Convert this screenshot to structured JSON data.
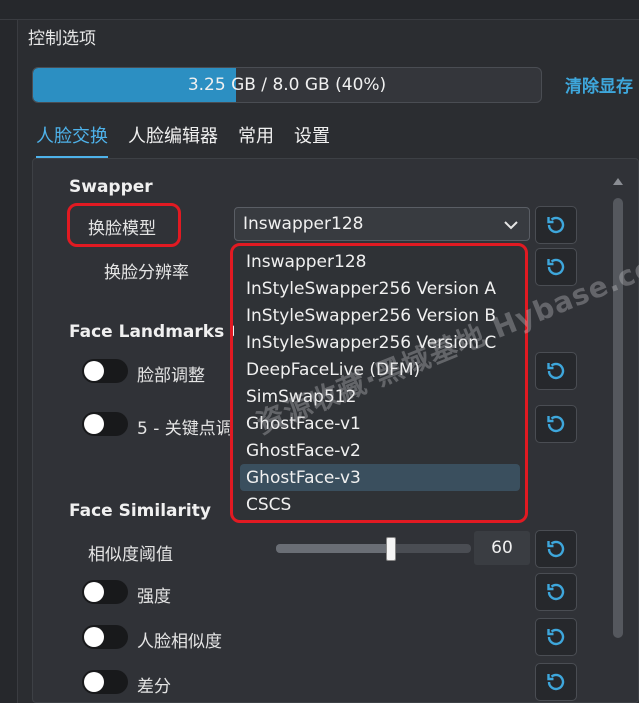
{
  "panel": {
    "title": "控制选项"
  },
  "vram": {
    "text": "3.25 GB / 8.0 GB (40%)",
    "percent": 40,
    "clear_label": "清除显存"
  },
  "tabs": [
    {
      "label": "人脸交换",
      "active": true
    },
    {
      "label": "人脸编辑器",
      "active": false
    },
    {
      "label": "常用",
      "active": false
    },
    {
      "label": "设置",
      "active": false
    }
  ],
  "sections": {
    "swapper": "Swapper",
    "landmarks": "Face Landmarks C",
    "similarity": "Face Similarity"
  },
  "swapper": {
    "model_label": "换脸模型",
    "model_value": "Inswapper128",
    "resolution_label": "换脸分辨率"
  },
  "landmarks": {
    "face_adjust_label": "脸部调整",
    "keypoints_label": "5 - 关键点调"
  },
  "similarity": {
    "threshold_label": "相似度阈值",
    "threshold_value": "60",
    "threshold_fraction": 0.6,
    "strength_label": "强度",
    "face_similarity_label": "人脸相似度",
    "diff_label": "差分"
  },
  "dropdown": {
    "options": [
      "Inswapper128",
      "InStyleSwapper256 Version A",
      "InStyleSwapper256 Version B",
      "InStyleSwapper256 Version C",
      "DeepFaceLive (DFM)",
      "SimSwap512",
      "GhostFace-v1",
      "GhostFace-v2",
      "GhostFace-v3",
      "CSCS"
    ],
    "selected": "GhostFace-v3"
  },
  "watermark": "资源收藏·黑域基地 Hybase.com",
  "colors": {
    "accent": "#4eb2ea",
    "vram_fill": "#2c8fc2",
    "highlight": "#e11a22",
    "reset_icon": "#3ea7dc"
  },
  "icons": {
    "reset": "reset-icon",
    "chevron": "chevron-down-icon"
  }
}
